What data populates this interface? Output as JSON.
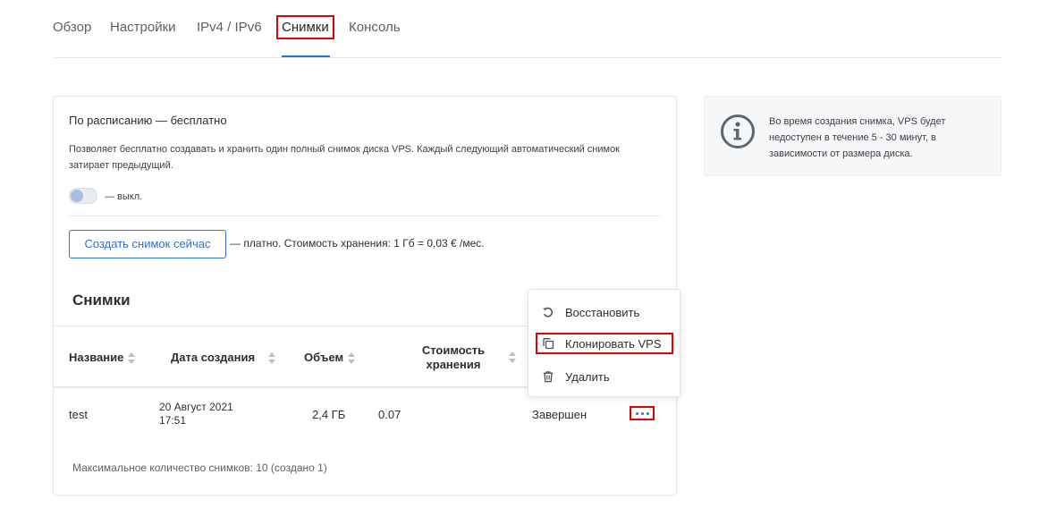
{
  "tabs": {
    "overview": "Обзор",
    "settings": "Настройки",
    "ip": "IPv4 / IPv6",
    "snapshots": "Снимки",
    "console": "Консоль"
  },
  "schedule": {
    "title": "По расписанию — бесплатно",
    "description": "Позволяет бесплатно создавать и хранить один полный снимок диска VPS. Каждый следующий автоматический снимок затирает предыдущий.",
    "toggle_label": "— выкл.",
    "toggle_on": false
  },
  "create": {
    "button_label": "Создать снимок сейчас",
    "note": "— платно. Стоимость хранения: 1 Гб = 0,03 € /мес."
  },
  "snapshots": {
    "title": "Снимки",
    "columns": {
      "name": "Название",
      "created": "Дата создания",
      "size": "Объем",
      "cost": "Стоимость хранения"
    },
    "rows": [
      {
        "name": "test",
        "date": "20 Август 2021",
        "time": "17:51",
        "size": "2,4 ГБ",
        "cost": "0.07",
        "status": "Завершен"
      }
    ],
    "footer": "Максимальное количество снимков: 10 (создано 1)"
  },
  "menu": {
    "restore": "Восстановить",
    "clone": "Клонировать VPS",
    "delete": "Удалить"
  },
  "info": {
    "text": "Во время создания снимка, VPS будет недоступен в течение 5 - 30 минут, в зависимости от размера диска."
  },
  "colors": {
    "accent": "#2e6fd1",
    "highlight": "#e00000"
  }
}
